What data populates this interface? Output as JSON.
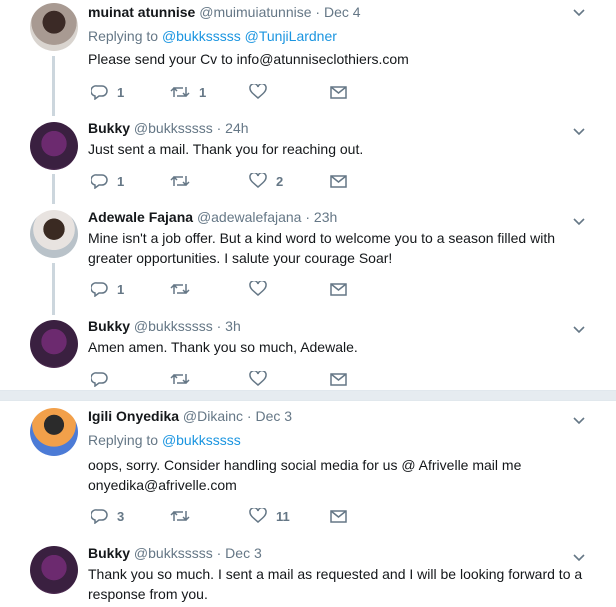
{
  "tweets": [
    {
      "name": "muinat atunnise",
      "handle": "@muimuiatunnise",
      "sep": " · ",
      "time": "Dec 4",
      "replying_prefix": "Replying to ",
      "replying_to": [
        "@bukksssss",
        "@TunjiLardner"
      ],
      "text_lines": [
        "Please send your Cv to info@atunniseclothiers.com"
      ],
      "replies": "1",
      "retweets": "1",
      "likes": ""
    },
    {
      "name": "Bukky",
      "handle": "@bukksssss",
      "sep": " · ",
      "time": "24h",
      "text_lines": [
        "Just sent a mail. Thank you for reaching out."
      ],
      "replies": "1",
      "retweets": "",
      "likes": "2"
    },
    {
      "name": "Adewale Fajana",
      "handle": "@adewalefajana",
      "sep": " · ",
      "time": "23h",
      "text_lines": [
        "Mine isn't a job offer. But a kind word to welcome you to a season filled with",
        "greater opportunities. I salute your courage Soar!"
      ],
      "replies": "1",
      "retweets": "",
      "likes": ""
    },
    {
      "name": "Bukky",
      "handle": "@bukksssss",
      "sep": " · ",
      "time": "3h",
      "text_lines": [
        "Amen amen. Thank you so much, Adewale."
      ],
      "replies": "",
      "retweets": "",
      "likes": ""
    },
    {
      "name": "Igili Onyedika",
      "handle": "@Dikainc",
      "sep": " · ",
      "time": "Dec 3",
      "replying_prefix": "Replying to ",
      "replying_to": [
        "@bukksssss"
      ],
      "text_lines": [
        "oops, sorry. Consider handling social media for us @ Afrivelle mail me",
        "onyedika@afrivelle.com"
      ],
      "replies": "3",
      "retweets": "",
      "likes": "11"
    },
    {
      "name": "Bukky",
      "handle": "@bukksssss",
      "sep": " · ",
      "time": "Dec 3",
      "text_lines": [
        "Thank you so much. I sent a mail as requested and I will be looking forward to a",
        "response from you."
      ],
      "replies": "",
      "retweets": "",
      "likes": ""
    }
  ],
  "icons": {
    "reply": "reply-icon",
    "retweet": "retweet-icon",
    "like": "heart-icon",
    "dm": "envelope-icon",
    "caret": "chevron-down-icon"
  },
  "colors": {
    "link": "#1b95e0",
    "muted": "#657786",
    "thread_line": "#ccd6dd"
  }
}
